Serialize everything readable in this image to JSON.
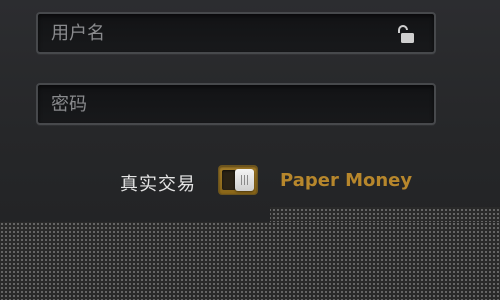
{
  "login_form": {
    "username": {
      "placeholder": "用户名",
      "value": "",
      "icon": "lock-open-icon"
    },
    "password": {
      "placeholder": "密码",
      "value": ""
    },
    "mode_toggle": {
      "left_label": "真实交易",
      "right_label": "Paper Money",
      "selected": "Paper Money",
      "accent_color": "#b7872c"
    }
  }
}
